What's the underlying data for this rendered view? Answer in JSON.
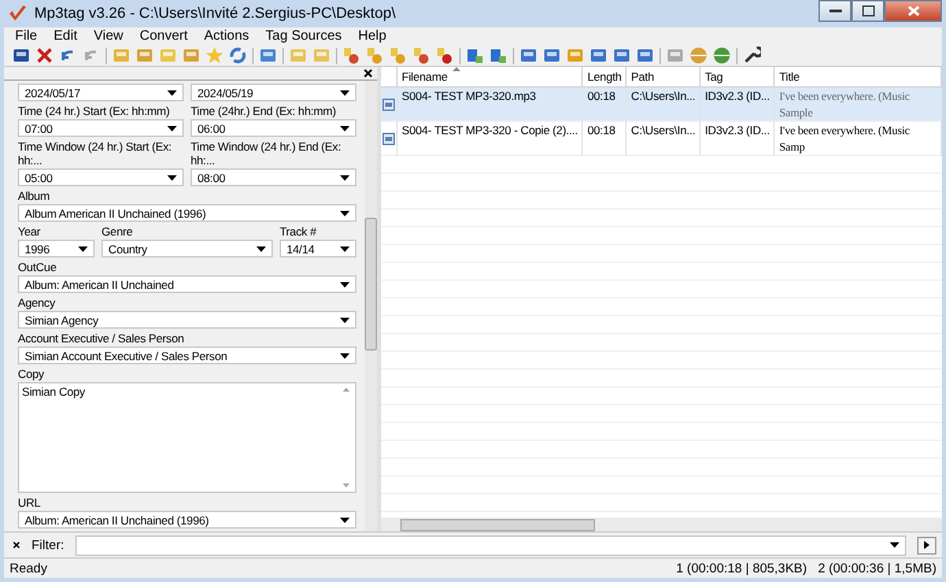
{
  "window": {
    "title": "Mp3tag v3.26  -  C:\\Users\\Invité 2.Sergius-PC\\Desktop\\"
  },
  "menu": [
    "File",
    "Edit",
    "View",
    "Convert",
    "Actions",
    "Tag Sources",
    "Help"
  ],
  "tag_panel": {
    "rows": [
      {
        "fields": [
          {
            "value": "2024/05/17",
            "kind": "dropdown"
          },
          {
            "value": "2024/05/19",
            "kind": "dropdown"
          }
        ]
      },
      {
        "fields": [
          {
            "label": "Time (24 hr.) Start (Ex: hh:mm)",
            "value": "07:00",
            "kind": "dropdown"
          },
          {
            "label": "Time (24hr.) End   (Ex: hh:mm)",
            "value": "06:00",
            "kind": "dropdown"
          }
        ]
      },
      {
        "fields": [
          {
            "label": "Time Window (24 hr.) Start (Ex: hh:...",
            "value": "05:00",
            "kind": "dropdown"
          },
          {
            "label": "Time Window (24 hr.) End (Ex: hh:...",
            "value": "08:00",
            "kind": "dropdown"
          }
        ]
      },
      {
        "fields": [
          {
            "label": "Album",
            "value": "Album American II Unchained (1996)",
            "kind": "dropdown"
          }
        ]
      },
      {
        "fields": [
          {
            "label": "Year",
            "value": "1996",
            "kind": "dropdown"
          },
          {
            "label": "Genre",
            "value": "Country",
            "kind": "dropdown"
          },
          {
            "label": "Track #",
            "value": "14/14",
            "kind": "dropdown"
          }
        ]
      },
      {
        "fields": [
          {
            "label": "OutCue",
            "value": "Album: American II Unchained",
            "kind": "dropdown"
          }
        ]
      },
      {
        "fields": [
          {
            "label": "Agency",
            "value": "Simian Agency",
            "kind": "dropdown"
          }
        ]
      },
      {
        "fields": [
          {
            "label": "Account Executive / Sales Person",
            "value": "Simian Account Executive / Sales Person",
            "kind": "dropdown"
          }
        ]
      },
      {
        "fields": [
          {
            "label": "Copy",
            "value": "Simian Copy",
            "kind": "textarea"
          }
        ]
      },
      {
        "fields": [
          {
            "label": "URL",
            "value": "Album: American II Unchained (1996)",
            "kind": "dropdown"
          }
        ]
      }
    ]
  },
  "table": {
    "columns": [
      {
        "label": "Filename",
        "sorted": true
      },
      {
        "label": "Length",
        "sorted": false
      },
      {
        "label": "Path",
        "sorted": false
      },
      {
        "label": "Tag",
        "sorted": false
      },
      {
        "label": "Title",
        "sorted": false
      }
    ],
    "rows": [
      {
        "selected": true,
        "cells": [
          "S004- TEST MP3-320.mp3",
          "00:18",
          "C:\\Users\\In...",
          "ID3v2.3 (ID...",
          "I've been everywhere. (Music Sample"
        ]
      },
      {
        "selected": false,
        "cells": [
          "S004- TEST MP3-320 - Copie (2)....",
          "00:18",
          "C:\\Users\\In...",
          "ID3v2.3 (ID...",
          "I've been everywhere. (Music Samp"
        ]
      }
    ]
  },
  "filter": {
    "label": "Filter:"
  },
  "status_bar": {
    "text": "Ready",
    "selection": "1 (00:00:18 | 805,3KB)",
    "total": "2 (00:00:36 | 1,5MB)"
  }
}
